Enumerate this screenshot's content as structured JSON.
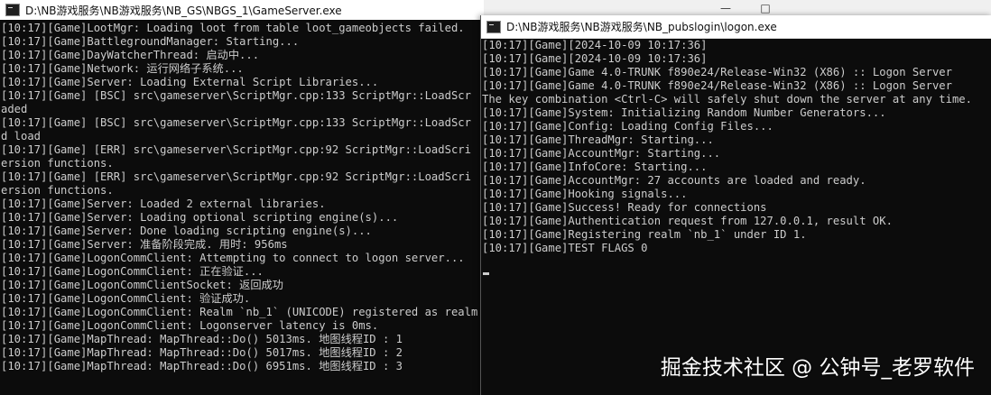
{
  "game_window": {
    "title": "D:\\NB游戏服务\\NB游戏服务\\NB_GS\\NBGS_1\\GameServer.exe",
    "lines": [
      "[10:17][Game]LootMgr: Loading loot from table loot_gameobjects failed.",
      "[10:17][Game]BattlegroundManager: Starting...",
      "[10:17][Game]DayWatcherThread: 启动中...",
      "[10:17][Game]Network: 运行网络子系统...",
      "[10:17][Game]Server: Loading External Script Libraries...",
      "[10:17][Game] [BSC] src\\gameserver\\ScriptMgr.cpp:133 ScriptMgr::LoadScr",
      "aded",
      "[10:17][Game] [BSC] src\\gameserver\\ScriptMgr.cpp:133 ScriptMgr::LoadScr",
      "d load",
      "[10:17][Game] [ERR] src\\gameserver\\ScriptMgr.cpp:92 ScriptMgr::LoadScri",
      "ersion functions.",
      "[10:17][Game] [ERR] src\\gameserver\\ScriptMgr.cpp:92 ScriptMgr::LoadScri",
      "ersion functions.",
      "[10:17][Game]Server: Loaded 2 external libraries.",
      "[10:17][Game]Server: Loading optional scripting engine(s)...",
      "[10:17][Game]Server: Done loading scripting engine(s)...",
      "[10:17][Game]Server: 准备阶段完成. 用时: 956ms",
      "[10:17][Game]LogonCommClient: Attempting to connect to logon server...",
      "[10:17][Game]LogonCommClient: 正在验证...",
      "[10:17][Game]LogonCommClientSocket: 返回成功",
      "[10:17][Game]LogonCommClient: 验证成功.",
      "[10:17][Game]LogonCommClient: Realm `nb_1` (UNICODE) registered as realm",
      "[10:17][Game]LogonCommClient: Logonserver latency is 0ms.",
      "[10:17][Game]MapThread: MapThread::Do() 5013ms. 地图线程ID : 1",
      "[10:17][Game]MapThread: MapThread::Do() 5017ms. 地图线程ID : 2",
      "[10:17][Game]MapThread: MapThread::Do() 6951ms. 地图线程ID : 3"
    ]
  },
  "logon_window": {
    "title": "D:\\NB游戏服务\\NB游戏服务\\NB_pubslogin\\logon.exe",
    "lines": [
      "[10:17][Game][2024-10-09 10:17:36]",
      "[10:17][Game][2024-10-09 10:17:36]",
      "[10:17][Game]Game 4.0-TRUNK f890e24/Release-Win32 (X86) :: Logon Server",
      "[10:17][Game]Game 4.0-TRUNK f890e24/Release-Win32 (X86) :: Logon Server",
      "The key combination <Ctrl-C> will safely shut down the server at any time.",
      "[10:17][Game]System: Initializing Random Number Generators...",
      "[10:17][Game]Config: Loading Config Files...",
      "[10:17][Game]ThreadMgr: Starting...",
      "[10:17][Game]AccountMgr: Starting...",
      "[10:17][Game]InfoCore: Starting...",
      "[10:17][Game]AccountMgr: 27 accounts are loaded and ready.",
      "[10:17][Game]Hooking signals...",
      "[10:17][Game]Success! Ready for connections",
      "[10:17][Game]Authentication request from 127.0.0.1, result OK.",
      "[10:17][Game]Registering realm `nb_1` under ID 1.",
      "[10:17][Game]TEST FLAGS 0"
    ]
  },
  "watermark": "掘金技术社区 @ 公钟号_老罗软件",
  "controls": {
    "minimize": "—",
    "maximize": "□"
  }
}
